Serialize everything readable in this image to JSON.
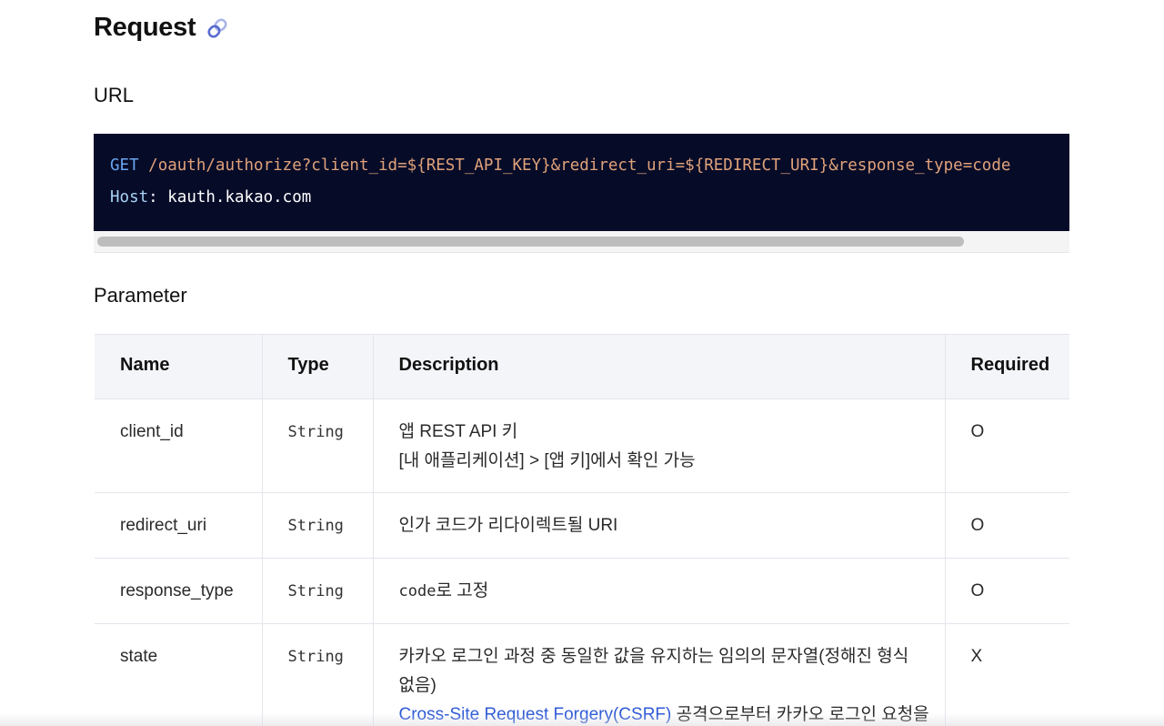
{
  "request": {
    "title": "Request",
    "link_icon": "link-icon"
  },
  "url_section": {
    "title": "URL",
    "code": {
      "method": "GET",
      "path": "/oauth/authorize?client_id=${REST_API_KEY}&redirect_uri=${REDIRECT_URI}&response_type=code",
      "host_key": "Host",
      "host_sep": ":",
      "host_value": "kauth.kakao.com"
    }
  },
  "parameter_section": {
    "title": "Parameter",
    "headers": {
      "name": "Name",
      "type": "Type",
      "description": "Description",
      "required": "Required"
    },
    "rows": [
      {
        "name": "client_id",
        "type": "String",
        "desc_line1": "앱 REST API 키",
        "desc_line2": "[내 애플리케이션] > [앱 키]에서 확인 가능",
        "required": "O"
      },
      {
        "name": "redirect_uri",
        "type": "String",
        "desc_line1": "인가 코드가 리다이렉트될 URI",
        "required": "O"
      },
      {
        "name": "response_type",
        "type": "String",
        "desc_code": "code",
        "desc_text": "로 고정",
        "required": "O"
      },
      {
        "name": "state",
        "type": "String",
        "desc_line1": "카카오 로그인 과정 중 동일한 값을 유지하는 임의의 문자열(정해진 형식",
        "desc_line2": "없음)",
        "desc_link": "Cross-Site Request Forgery(CSRF)",
        "desc_link_after": " 공격으로부터 카카오 로그인 요청을",
        "required": "X"
      }
    ]
  },
  "colors": {
    "code_bg": "#060b28",
    "code_method": "#6aa6f0",
    "code_path": "#e0a27a",
    "link": "#2d59d6",
    "table_header_bg": "#f4f5f8"
  }
}
